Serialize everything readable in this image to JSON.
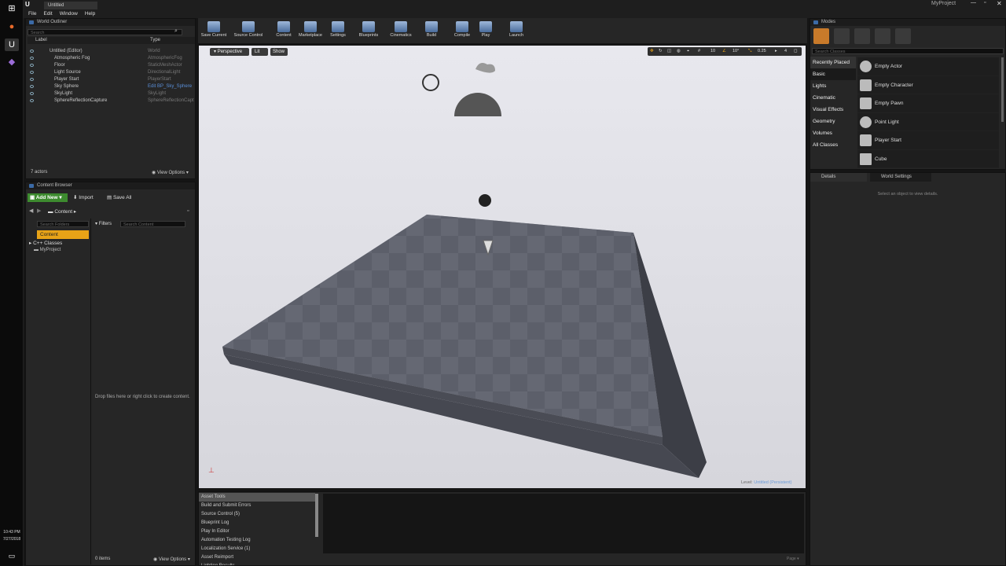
{
  "window": {
    "tab_title": "Untitled",
    "project": "MyProject"
  },
  "menu": [
    "File",
    "Edit",
    "Window",
    "Help"
  ],
  "taskbar": {
    "time": "10:43 PM",
    "date": "7/27/2018"
  },
  "world_outliner": {
    "tab": "World Outliner",
    "search_placeholder": "Search",
    "col_label": "Label",
    "col_type": "Type",
    "rows": [
      {
        "label": "Untitled (Editor)",
        "type": "World"
      },
      {
        "label": "Atmospheric Fog",
        "type": "AtmosphericFog"
      },
      {
        "label": "Floor",
        "type": "StaticMeshActor"
      },
      {
        "label": "Light Source",
        "type": "DirectionalLight"
      },
      {
        "label": "Player Start",
        "type": "PlayerStart"
      },
      {
        "label": "Sky Sphere",
        "type": "Edit BP_Sky_Sphere"
      },
      {
        "label": "SkyLight",
        "type": "SkyLight"
      },
      {
        "label": "SphereReflectionCapture",
        "type": "SphereReflectionCapt"
      }
    ],
    "actors": "7 actors",
    "view_options": "View Options"
  },
  "content_browser": {
    "tab": "Content Browser",
    "add_new": "Add New",
    "import": "Import",
    "save_all": "Save All",
    "path": "Content",
    "search_folders": "Search Folders",
    "filters": "Filters",
    "search_content": "Search Content",
    "tree": [
      "Content",
      "C++ Classes",
      "MyProject"
    ],
    "drop_hint": "Drop files here or right click to create content.",
    "items": "0 items",
    "view_options": "View Options"
  },
  "toolbar": [
    "Save Current",
    "Source Control",
    "Content",
    "Marketplace",
    "Settings",
    "Blueprints",
    "Cinematics",
    "Build",
    "Compile",
    "Play",
    "Launch"
  ],
  "viewport": {
    "perspective": "Perspective",
    "lit": "Lit",
    "show": "Show",
    "grid": "10",
    "angle": "10°",
    "scale": "0.25",
    "cam": "4",
    "level_label": "Level:",
    "level_name": "Untitled (Persistent)"
  },
  "modes": {
    "tab": "Modes",
    "search_placeholder": "Search Classes",
    "categories": [
      "Recently Placed",
      "Basic",
      "Lights",
      "Cinematic",
      "Visual Effects",
      "Geometry",
      "Volumes",
      "All Classes"
    ],
    "items": [
      "Empty Actor",
      "Empty Character",
      "Empty Pawn",
      "Point Light",
      "Player Start",
      "Cube"
    ]
  },
  "details": {
    "tab": "Details",
    "world_settings": "World Settings",
    "hint": "Select an object to view details."
  },
  "message_log": {
    "items": [
      "Asset Tools",
      "Build and Submit Errors",
      "Source Control (5)",
      "Blueprint Log",
      "Play In Editor",
      "Automation Testing Log",
      "Localization Service (1)",
      "Asset Reimport",
      "Lighting Results"
    ],
    "page": "Page"
  }
}
